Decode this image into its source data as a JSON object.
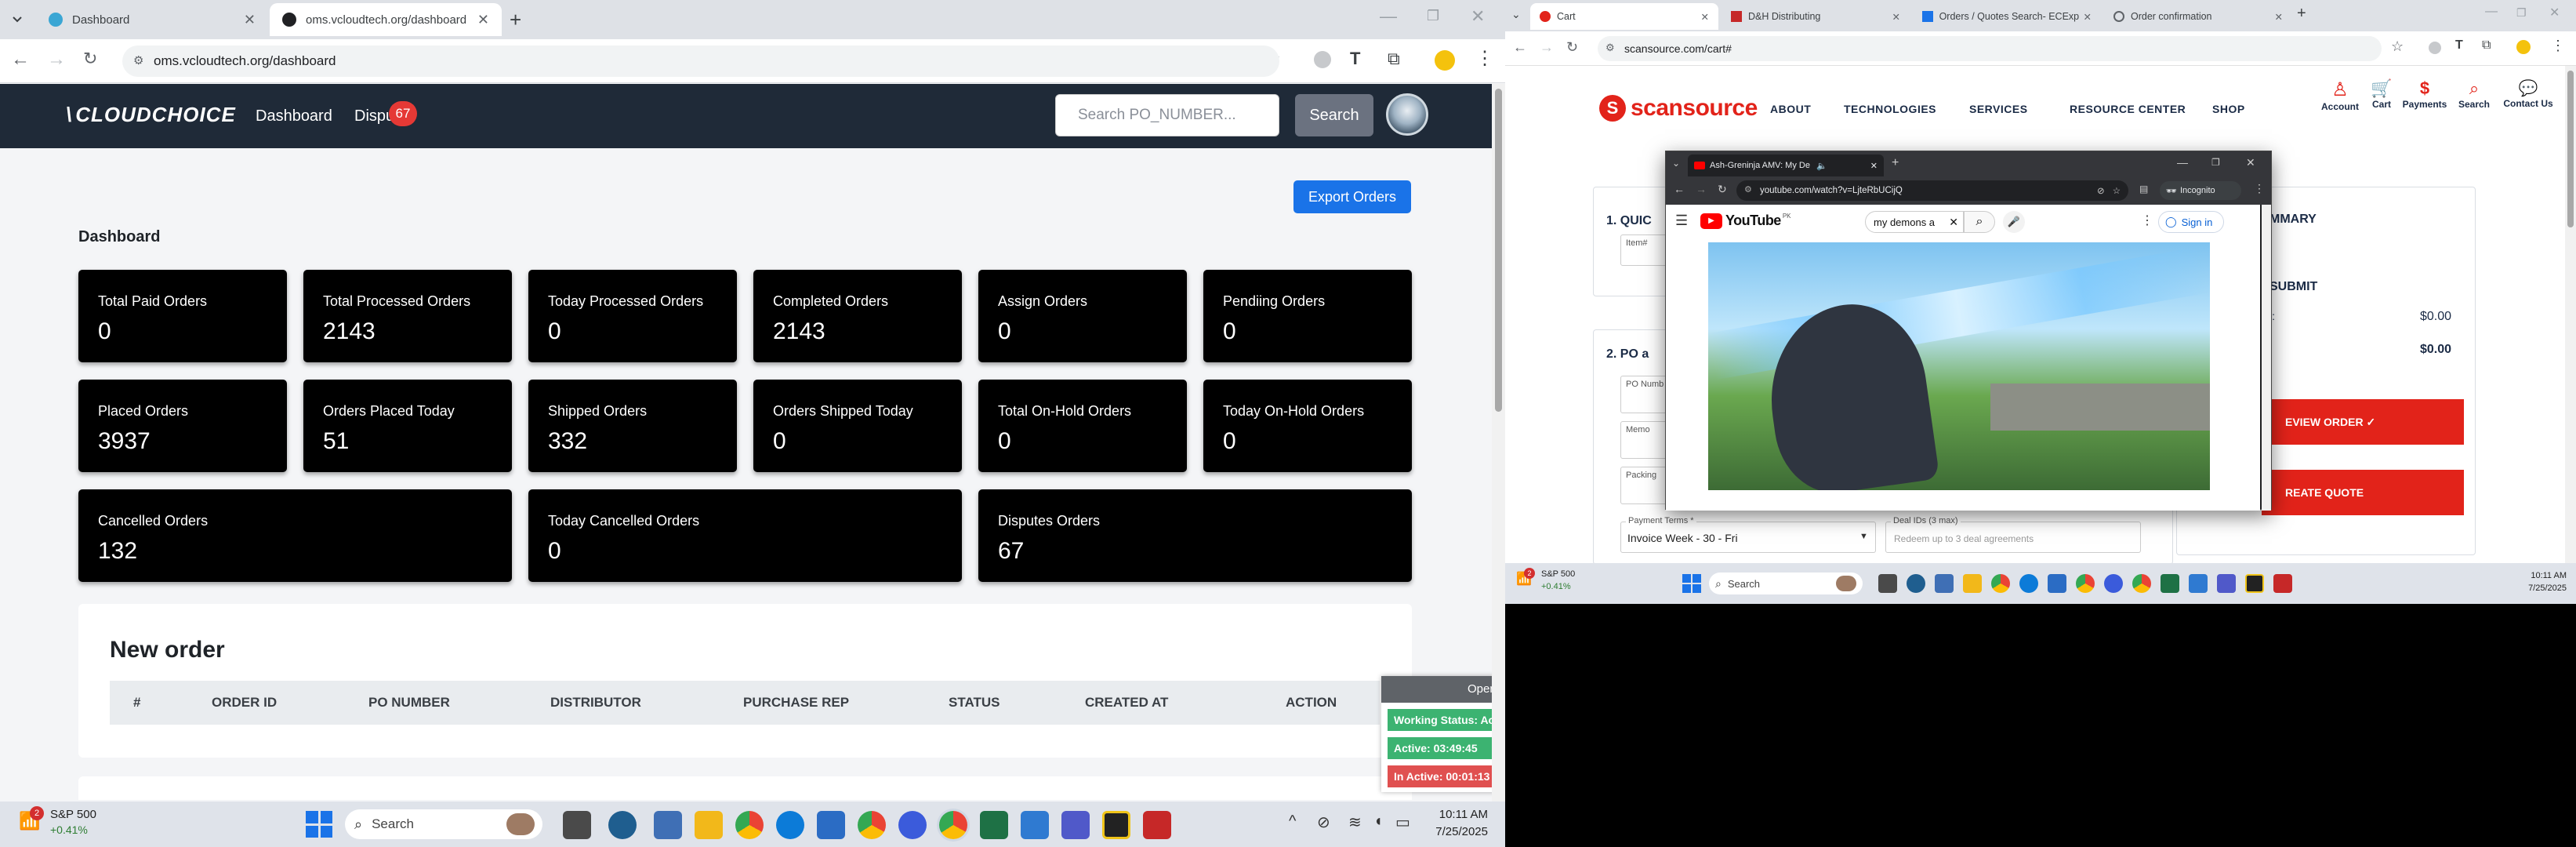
{
  "left_browser": {
    "tabs": [
      {
        "title": "Dashboard",
        "active": false
      },
      {
        "title": "oms.vcloudtech.org/dashboard",
        "active": true
      }
    ],
    "url": "oms.vcloudtech.org/dashboard"
  },
  "app": {
    "brand": "CLOUDCHOICE",
    "nav": [
      {
        "label": "Dashboard"
      },
      {
        "label": "Dispu"
      }
    ],
    "dispute_badge": "67",
    "search_placeholder": "Search PO_NUMBER...",
    "search_button": "Search",
    "export_button": "Export Orders",
    "section_title": "Dashboard",
    "cards_row1": [
      {
        "label": "Total Paid Orders",
        "value": "0"
      },
      {
        "label": "Total Processed Orders",
        "value": "2143"
      },
      {
        "label": "Today Processed Orders",
        "value": "0"
      },
      {
        "label": "Completed Orders",
        "value": "2143"
      },
      {
        "label": "Assign Orders",
        "value": "0"
      },
      {
        "label": "Pendiing Orders",
        "value": "0"
      }
    ],
    "cards_row2": [
      {
        "label": "Placed Orders",
        "value": "3937"
      },
      {
        "label": "Orders Placed Today",
        "value": "51"
      },
      {
        "label": "Shipped Orders",
        "value": "332"
      },
      {
        "label": "Orders Shipped Today",
        "value": "0"
      },
      {
        "label": "Total On-Hold Orders",
        "value": "0"
      },
      {
        "label": "Today On-Hold Orders",
        "value": "0"
      }
    ],
    "cards_row3": [
      {
        "label": "Cancelled Orders",
        "value": "132"
      },
      {
        "label": "Today Cancelled Orders",
        "value": "0"
      },
      {
        "label": "Disputes Orders",
        "value": "67"
      }
    ],
    "new_order": {
      "title": "New order",
      "columns": [
        "#",
        "ORDER ID",
        "PO NUMBER",
        "DISTRIBUTOR",
        "PURCHASE REP",
        "STATUS",
        "CREATED AT",
        "ACTION"
      ]
    },
    "status_widget": {
      "open": "Open A",
      "working": "Working Status: Act",
      "active": "Active: 03:49:45",
      "inactive": "In Active: 00:01:13"
    }
  },
  "left_taskbar": {
    "weather_title": "S&P 500",
    "weather_value": "+0.41%",
    "weather_badge": "2",
    "search": "Search",
    "time": "10:11 AM",
    "date": "7/25/2025"
  },
  "right_browser": {
    "tabs": [
      {
        "title": "Cart",
        "active": true
      },
      {
        "title": "D&H Distributing",
        "active": false
      },
      {
        "title": "Orders / Quotes Search- ECExp",
        "active": false
      },
      {
        "title": "Order confirmation",
        "active": false
      }
    ],
    "url": "scansource.com/cart#"
  },
  "scansource": {
    "logo": "scansource",
    "menu": [
      "ABOUT",
      "TECHNOLOGIES",
      "SERVICES",
      "RESOURCE CENTER",
      "SHOP"
    ],
    "icons": [
      {
        "label": "Account",
        "icon": "user-icon"
      },
      {
        "label": "Cart",
        "icon": "cart-icon"
      },
      {
        "label": "Payments",
        "icon": "dollar-icon"
      },
      {
        "label": "Search",
        "icon": "search-icon"
      },
      {
        "label": "Contact Us",
        "icon": "chat-icon"
      }
    ],
    "section1": "1. QUIC",
    "item_label": "Item#",
    "section2": "2. PO a",
    "po_label": "PO Numb",
    "memo_label": "Memo",
    "packing_label": "Packing",
    "payment_terms_label": "Payment Terms *",
    "payment_terms_value": "Invoice Week - 30 - Fri",
    "deal_ids_label": "Deal IDs (3 max)",
    "deal_ids_placeholder": "Redeem up to 3 deal agreements",
    "summary_title": "MMARY",
    "submit_title": "SUBMIT",
    "row1_label": "l:",
    "row1_value": "$0.00",
    "row2_label": "l",
    "row2_value": "$0.00",
    "review_btn": "EVIEW ORDER ✓",
    "quote_btn": "REATE QUOTE"
  },
  "youtube": {
    "tab_title": "Ash-Greninja AMV: My De",
    "url": "youtube.com/watch?v=LjteRbUCijQ",
    "incognito": "Incognito",
    "logo": "YouTube",
    "region": "PK",
    "search_value": "my demons a",
    "sign_in": "Sign in"
  },
  "right_taskbar": {
    "weather_title": "S&P 500",
    "weather_value": "+0.41%",
    "weather_badge": "2",
    "search": "Search",
    "time": "10:11 AM",
    "date": "7/25/2025"
  },
  "colors": {
    "nav_bg": "#1f2a38",
    "export_btn": "#1a73e8",
    "badge": "#e53935",
    "scansource_red": "#e2231a",
    "status_green": "#3cb371",
    "status_red": "#e05050"
  }
}
